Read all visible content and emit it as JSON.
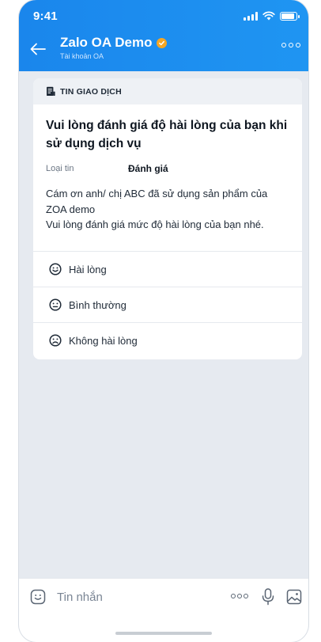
{
  "status_bar": {
    "time": "9:41"
  },
  "header": {
    "title": "Zalo OA Demo",
    "subtitle": "Tài khoản OA"
  },
  "card": {
    "header_label": "TIN GIAO DỊCH",
    "title": "Vui lòng đánh giá độ hài lòng của bạn khi sử dụng dịch vụ",
    "meta_label": "Loại tin",
    "meta_value": "Đánh giá",
    "body_line1": "Cám ơn anh/ chị ABC đã sử dụng sản phẩm của ZOA demo",
    "body_line2": "Vui lòng đánh giá mức độ hài lòng của bạn nhé.",
    "options": [
      {
        "label": "Hài lòng",
        "icon": "happy-face-icon"
      },
      {
        "label": "Bình thường",
        "icon": "neutral-face-icon"
      },
      {
        "label": "Không hài lòng",
        "icon": "sad-face-icon"
      }
    ]
  },
  "composer": {
    "placeholder": "Tin nhắn"
  },
  "colors": {
    "header": "#1a86ec",
    "verified_badge": "#f5a623",
    "background": "#e6eaf0"
  }
}
